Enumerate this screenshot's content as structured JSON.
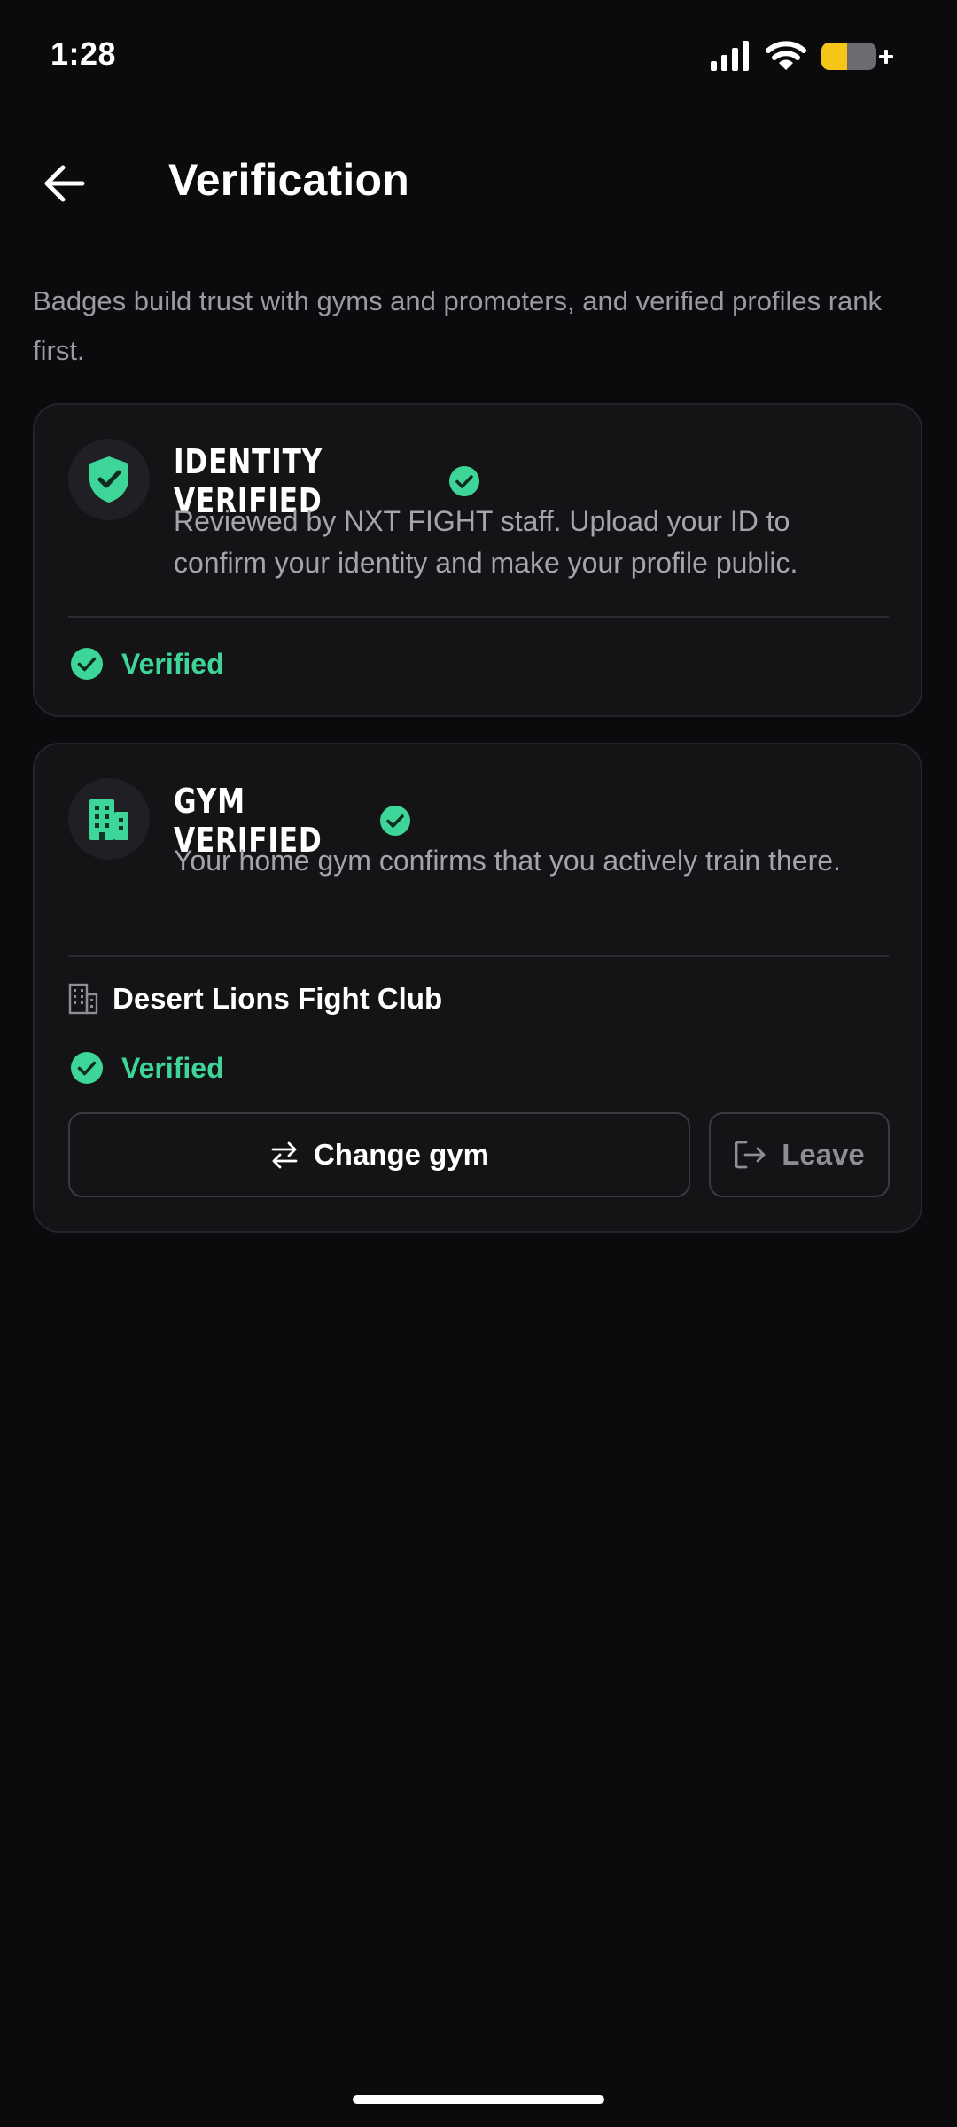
{
  "status_bar": {
    "time": "1:28",
    "icons": [
      "cellular-signal-icon",
      "wifi-icon",
      "battery-charging-icon"
    ],
    "battery_color": "#f5c518"
  },
  "header": {
    "back_icon": "arrow-left-icon",
    "title": "Verification"
  },
  "intro": "Badges build trust with gyms and promoters, and verified profiles rank first.",
  "colors": {
    "accent": "#3ed598",
    "background": "#0b0b0d",
    "card": "#141417"
  },
  "identity_card": {
    "icon": "shield-check-icon",
    "title": "IDENTITY VERIFIED",
    "title_badge_icon": "check-circle-icon",
    "description": "Reviewed by NXT FIGHT staff. Upload your ID to confirm your identity and make your profile public.",
    "status": "Verified"
  },
  "gym_card": {
    "icon": "building-icon",
    "title": "GYM VERIFIED",
    "title_badge_icon": "check-circle-icon",
    "description": "Your home gym confirms that you actively train there.",
    "gym_name": "Desert Lions Fight Club",
    "status": "Verified",
    "change_button": {
      "label": "Change gym",
      "icon": "swap-arrows-icon"
    },
    "leave_button": {
      "label": "Leave",
      "icon": "exit-icon"
    }
  }
}
